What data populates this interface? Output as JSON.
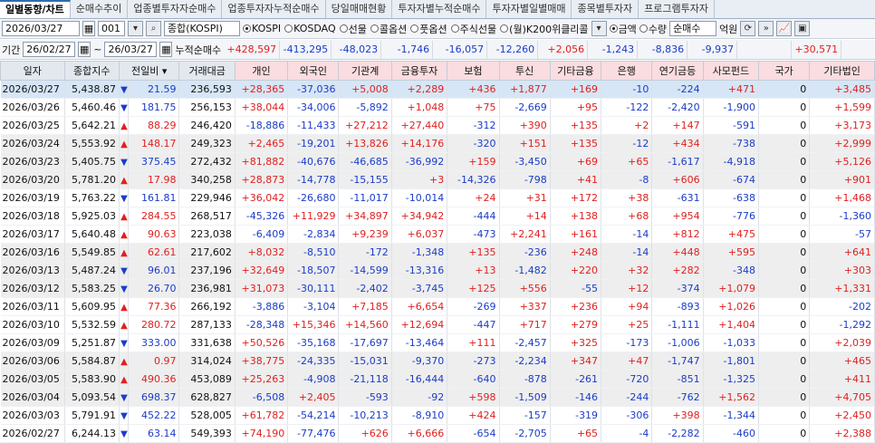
{
  "tabs": [
    "일별동향/차트",
    "순매수추이",
    "업종별투자자순매수",
    "업종투자자누적순매수",
    "당일매매현황",
    "투자자별누적순매수",
    "투자자별일별매매",
    "종목별투자자",
    "프로그램투자자"
  ],
  "controls": {
    "date": "2026/03/27",
    "code": "001",
    "index_name": "종합(KOSPI)",
    "markets": [
      {
        "label": "KOSPI",
        "selected": true
      },
      {
        "label": "KOSDAQ",
        "selected": false
      },
      {
        "label": "선물",
        "selected": false
      },
      {
        "label": "콜옵션",
        "selected": false
      },
      {
        "label": "풋옵션",
        "selected": false
      },
      {
        "label": "주식선물",
        "selected": false
      },
      {
        "label": "(월)K200위클리콜",
        "selected": false
      }
    ],
    "metric_amount": "금액",
    "metric_qty": "수량",
    "mode": "순매수",
    "unit": "억원"
  },
  "period": {
    "label": "기간",
    "from": "26/02/27",
    "to": "26/03/27",
    "cum_label": "누적순매수",
    "totals": [
      "+428,597",
      "-413,295",
      "-48,023",
      "-1,746",
      "-16,057",
      "-12,260",
      "+2,056",
      "-1,243",
      "-8,836",
      "-9,937",
      "",
      "+30,571"
    ]
  },
  "columns": [
    "일자",
    "종합지수",
    "전일비",
    "거래대금",
    "개인",
    "외국인",
    "기관계",
    "금융투자",
    "보험",
    "투신",
    "기타금융",
    "은행",
    "연기금등",
    "사모펀드",
    "국가",
    "기타법인"
  ],
  "rows": [
    [
      "2026/03/27",
      "5,438.87",
      "down",
      "21.59",
      "236,593",
      "+28,365",
      "-37,036",
      "+5,008",
      "+2,289",
      "+436",
      "+1,877",
      "+169",
      "-10",
      "-224",
      "+471",
      "0",
      "+3,485"
    ],
    [
      "2026/03/26",
      "5,460.46",
      "down",
      "181.75",
      "256,153",
      "+38,044",
      "-34,006",
      "-5,892",
      "+1,048",
      "+75",
      "-2,669",
      "+95",
      "-122",
      "-2,420",
      "-1,900",
      "0",
      "+1,599"
    ],
    [
      "2026/03/25",
      "5,642.21",
      "up",
      "88.29",
      "246,420",
      "-18,886",
      "-11,433",
      "+27,212",
      "+27,440",
      "-312",
      "+390",
      "+135",
      "+2",
      "+147",
      "-591",
      "0",
      "+3,173"
    ],
    [
      "2026/03/24",
      "5,553.92",
      "up",
      "148.17",
      "249,323",
      "+2,465",
      "-19,201",
      "+13,826",
      "+14,176",
      "-320",
      "+151",
      "+135",
      "-12",
      "+434",
      "-738",
      "0",
      "+2,999"
    ],
    [
      "2026/03/23",
      "5,405.75",
      "down",
      "375.45",
      "272,432",
      "+81,882",
      "-40,676",
      "-46,685",
      "-36,992",
      "+159",
      "-3,450",
      "+69",
      "+65",
      "-1,617",
      "-4,918",
      "0",
      "+5,126"
    ],
    [
      "2026/03/20",
      "5,781.20",
      "up",
      "17.98",
      "340,258",
      "+28,873",
      "-14,778",
      "-15,155",
      "+3",
      "-14,326",
      "-798",
      "+41",
      "-8",
      "+606",
      "-674",
      "0",
      "+901"
    ],
    [
      "2026/03/19",
      "5,763.22",
      "down",
      "161.81",
      "229,946",
      "+36,042",
      "-26,680",
      "-11,017",
      "-10,014",
      "+24",
      "+31",
      "+172",
      "+38",
      "-631",
      "-638",
      "0",
      "+1,468"
    ],
    [
      "2026/03/18",
      "5,925.03",
      "up",
      "284.55",
      "268,517",
      "-45,326",
      "+11,929",
      "+34,897",
      "+34,942",
      "-444",
      "+14",
      "+138",
      "+68",
      "+954",
      "-776",
      "0",
      "-1,360"
    ],
    [
      "2026/03/17",
      "5,640.48",
      "up",
      "90.63",
      "223,038",
      "-6,409",
      "-2,834",
      "+9,239",
      "+6,037",
      "-473",
      "+2,241",
      "+161",
      "-14",
      "+812",
      "+475",
      "0",
      "-57"
    ],
    [
      "2026/03/16",
      "5,549.85",
      "up",
      "62.61",
      "217,602",
      "+8,032",
      "-8,510",
      "-172",
      "-1,348",
      "+135",
      "-236",
      "+248",
      "-14",
      "+448",
      "+595",
      "0",
      "+641"
    ],
    [
      "2026/03/13",
      "5,487.24",
      "down",
      "96.01",
      "237,196",
      "+32,649",
      "-18,507",
      "-14,599",
      "-13,316",
      "+13",
      "-1,482",
      "+220",
      "+32",
      "+282",
      "-348",
      "0",
      "+303"
    ],
    [
      "2026/03/12",
      "5,583.25",
      "down",
      "26.70",
      "236,981",
      "+31,073",
      "-30,111",
      "-2,402",
      "-3,745",
      "+125",
      "+556",
      "-55",
      "+12",
      "-374",
      "+1,079",
      "0",
      "+1,331"
    ],
    [
      "2026/03/11",
      "5,609.95",
      "up",
      "77.36",
      "266,192",
      "-3,886",
      "-3,104",
      "+7,185",
      "+6,654",
      "-269",
      "+337",
      "+236",
      "+94",
      "-893",
      "+1,026",
      "0",
      "-202"
    ],
    [
      "2026/03/10",
      "5,532.59",
      "up",
      "280.72",
      "287,133",
      "-28,348",
      "+15,346",
      "+14,560",
      "+12,694",
      "-447",
      "+717",
      "+279",
      "+25",
      "-1,111",
      "+1,404",
      "0",
      "-1,292"
    ],
    [
      "2026/03/09",
      "5,251.87",
      "down",
      "333.00",
      "331,638",
      "+50,526",
      "-35,168",
      "-17,697",
      "-13,464",
      "+111",
      "-2,457",
      "+325",
      "-173",
      "-1,006",
      "-1,033",
      "0",
      "+2,039"
    ],
    [
      "2026/03/06",
      "5,584.87",
      "up",
      "0.97",
      "314,024",
      "+38,775",
      "-24,335",
      "-15,031",
      "-9,370",
      "-273",
      "-2,234",
      "+347",
      "+47",
      "-1,747",
      "-1,801",
      "0",
      "+465"
    ],
    [
      "2026/03/05",
      "5,583.90",
      "up",
      "490.36",
      "453,089",
      "+25,263",
      "-4,908",
      "-21,118",
      "-16,444",
      "-640",
      "-878",
      "-261",
      "-720",
      "-851",
      "-1,325",
      "0",
      "+411"
    ],
    [
      "2026/03/04",
      "5,093.54",
      "down",
      "698.37",
      "628,827",
      "-6,508",
      "+2,405",
      "-593",
      "-92",
      "+598",
      "-1,509",
      "-146",
      "-244",
      "-762",
      "+1,562",
      "0",
      "+4,705"
    ],
    [
      "2026/03/03",
      "5,791.91",
      "down",
      "452.22",
      "528,005",
      "+61,782",
      "-54,214",
      "-10,213",
      "-8,910",
      "+424",
      "-157",
      "-319",
      "-306",
      "+398",
      "-1,344",
      "0",
      "+2,450"
    ],
    [
      "2026/02/27",
      "6,244.13",
      "down",
      "63.14",
      "549,393",
      "+74,190",
      "-77,476",
      "+626",
      "+6,666",
      "-654",
      "-2,705",
      "+65",
      "-4",
      "-2,282",
      "-460",
      "0",
      "+2,388"
    ]
  ]
}
